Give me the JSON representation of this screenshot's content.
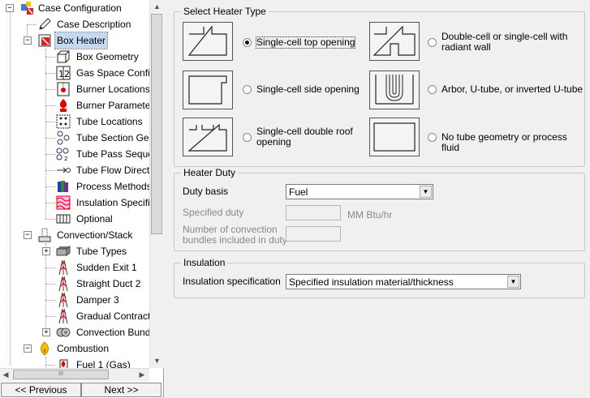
{
  "tree": {
    "items": [
      {
        "label": "Case Configuration",
        "icon": "case-configuration-icon"
      },
      {
        "label": "Case Description",
        "icon": "pencil-icon"
      },
      {
        "label": "Box Heater",
        "icon": "box-heater-icon"
      },
      {
        "label": "Box Geometry",
        "icon": "box-geometry-icon"
      },
      {
        "label": "Gas Space Configu",
        "icon": "gas-space-icon"
      },
      {
        "label": "Burner Locations",
        "icon": "burner-location-icon"
      },
      {
        "label": "Burner Paramete",
        "icon": "burner-parameters-icon"
      },
      {
        "label": "Tube Locations",
        "icon": "tube-locations-icon"
      },
      {
        "label": "Tube Section Geo",
        "icon": "tube-section-icon"
      },
      {
        "label": "Tube Pass Seque",
        "icon": "tube-pass-icon"
      },
      {
        "label": "Tube Flow Direct",
        "icon": "flow-direction-icon"
      },
      {
        "label": "Process Methods",
        "icon": "process-methods-icon"
      },
      {
        "label": "Insulation Specifi",
        "icon": "insulation-icon"
      },
      {
        "label": "Optional",
        "icon": "optional-icon"
      },
      {
        "label": "Convection/Stack",
        "icon": "convection-stack-icon"
      },
      {
        "label": "Tube Types",
        "icon": "tube-types-icon"
      },
      {
        "label": "Sudden Exit 1",
        "icon": "duct-icon"
      },
      {
        "label": "Straight Duct 2",
        "icon": "duct-icon"
      },
      {
        "label": "Damper 3",
        "icon": "duct-icon"
      },
      {
        "label": "Gradual Contract",
        "icon": "duct-icon"
      },
      {
        "label": "Convection Bund",
        "icon": "convection-bundle-icon"
      },
      {
        "label": "Combustion",
        "icon": "flame-icon"
      },
      {
        "label": "Fuel 1 (Gas)",
        "icon": "fuel-icon"
      }
    ]
  },
  "nav": {
    "previous": "<< Previous",
    "next": "Next >>"
  },
  "heater_type": {
    "title": "Select Heater Type",
    "options": [
      {
        "label": "Single-cell top opening",
        "selected": true,
        "icon": "single-cell-top-opening-diagram"
      },
      {
        "label": "Double-cell or single-cell with radiant wall",
        "selected": false,
        "icon": "double-cell-diagram"
      },
      {
        "label": "Single-cell side opening",
        "selected": false,
        "icon": "single-cell-side-opening-diagram"
      },
      {
        "label": "Arbor, U-tube, or inverted U-tube",
        "selected": false,
        "icon": "u-tube-diagram"
      },
      {
        "label": "Single-cell double roof opening",
        "selected": false,
        "icon": "double-roof-opening-diagram"
      },
      {
        "label": "No tube geometry or process fluid",
        "selected": false,
        "icon": "no-tube-diagram"
      }
    ]
  },
  "heater_duty": {
    "title": "Heater Duty",
    "duty_basis_label": "Duty basis",
    "duty_basis_value": "Fuel",
    "specified_duty_label": "Specified duty",
    "specified_duty_unit": "MM Btu/hr",
    "bundles_label_line1": "Number of convection",
    "bundles_label_line2": "bundles included in duty"
  },
  "insulation": {
    "title": "Insulation",
    "spec_label": "Insulation specification",
    "spec_value": "Specified insulation material/thickness"
  },
  "colors": {
    "selection": "#c4d9f0",
    "panel": "#f0f0f0",
    "flame": "#f5c400",
    "burner_red": "#e00000"
  }
}
